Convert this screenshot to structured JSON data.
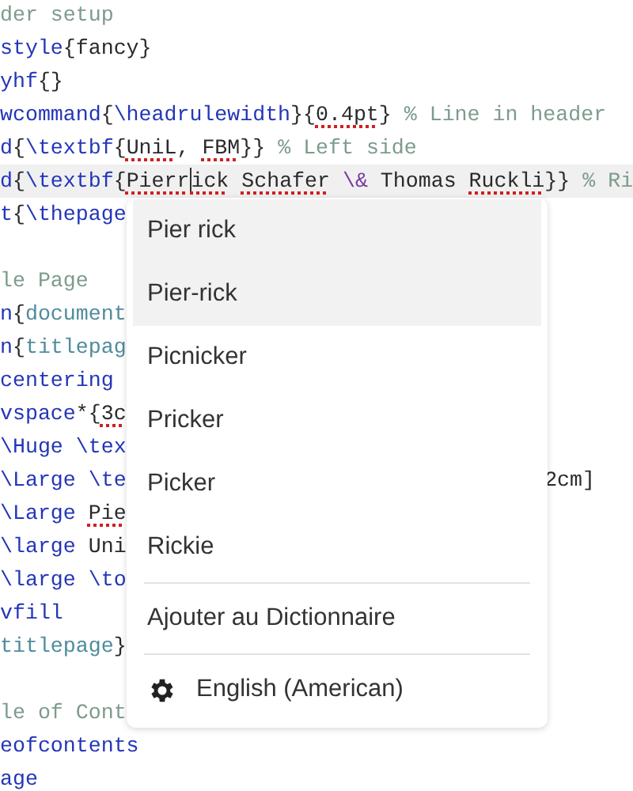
{
  "editor": {
    "lines": [
      {
        "kind": "code",
        "segments": [
          {
            "kind": "comment",
            "text": "der setup"
          }
        ]
      },
      {
        "kind": "code",
        "segments": [
          {
            "kind": "command",
            "text": "style"
          },
          {
            "kind": "text",
            "text": "{fancy}"
          }
        ]
      },
      {
        "kind": "code",
        "segments": [
          {
            "kind": "command",
            "text": "yhf"
          },
          {
            "kind": "text",
            "text": "{}"
          }
        ]
      },
      {
        "kind": "code",
        "segments": [
          {
            "kind": "command",
            "text": "wcommand"
          },
          {
            "kind": "text",
            "text": "{"
          },
          {
            "kind": "command",
            "text": "\\headrulewidth"
          },
          {
            "kind": "text",
            "text": "}{"
          },
          {
            "kind": "misspelled",
            "text": "0.4pt"
          },
          {
            "kind": "text",
            "text": "} "
          },
          {
            "kind": "comment",
            "text": "% Line in header"
          }
        ]
      },
      {
        "kind": "code",
        "segments": [
          {
            "kind": "command",
            "text": "d"
          },
          {
            "kind": "text",
            "text": "{"
          },
          {
            "kind": "command",
            "text": "\\textbf"
          },
          {
            "kind": "text",
            "text": "{"
          },
          {
            "kind": "misspelled",
            "text": "UniL"
          },
          {
            "kind": "text",
            "text": ", "
          },
          {
            "kind": "misspelled",
            "text": "FBM"
          },
          {
            "kind": "text",
            "text": "}} "
          },
          {
            "kind": "comment",
            "text": "% Left side"
          }
        ]
      },
      {
        "kind": "code",
        "current": true,
        "segments": [
          {
            "kind": "command",
            "text": "d"
          },
          {
            "kind": "text",
            "text": "{"
          },
          {
            "kind": "command",
            "text": "\\textbf"
          },
          {
            "kind": "text",
            "text": "{"
          },
          {
            "kind": "misspelled",
            "text": "Pierr"
          },
          {
            "kind": "cursor"
          },
          {
            "kind": "misspelled",
            "text": "ick"
          },
          {
            "kind": "misspelled",
            "text": "Schafer",
            "spaced": true
          },
          {
            "kind": "special",
            "text": "\\&",
            "spaced": true
          },
          {
            "kind": "text",
            "text": " Thomas "
          },
          {
            "kind": "misspelled",
            "text": "Ruckli"
          },
          {
            "kind": "text",
            "text": "}} "
          },
          {
            "kind": "comment",
            "text": "% Ri"
          }
        ]
      },
      {
        "kind": "code",
        "segments": [
          {
            "kind": "command",
            "text": "t"
          },
          {
            "kind": "text",
            "text": "{"
          },
          {
            "kind": "command",
            "text": "\\thepage"
          }
        ]
      },
      {
        "kind": "blank"
      },
      {
        "kind": "code",
        "segments": [
          {
            "kind": "comment",
            "text": "le Page"
          }
        ]
      },
      {
        "kind": "code",
        "segments": [
          {
            "kind": "command",
            "text": "n"
          },
          {
            "kind": "text",
            "text": "{"
          },
          {
            "kind": "env",
            "text": "document"
          }
        ]
      },
      {
        "kind": "code",
        "segments": [
          {
            "kind": "command",
            "text": "n"
          },
          {
            "kind": "text",
            "text": "{"
          },
          {
            "kind": "env",
            "text": "titlepag"
          }
        ]
      },
      {
        "kind": "code",
        "segments": [
          {
            "kind": "command",
            "text": "centering"
          }
        ]
      },
      {
        "kind": "code",
        "segments": [
          {
            "kind": "command",
            "text": "vspace"
          },
          {
            "kind": "text",
            "text": "*{"
          },
          {
            "kind": "misspelled",
            "text": "3c"
          }
        ]
      },
      {
        "kind": "code",
        "segments": [
          {
            "kind": "command",
            "text": "\\Huge"
          },
          {
            "kind": "command",
            "text": "\\tex",
            "spaced": true
          }
        ]
      },
      {
        "kind": "code",
        "segments": [
          {
            "kind": "command",
            "text": "\\Large"
          },
          {
            "kind": "command",
            "text": "\\te",
            "spaced": true
          }
        ],
        "tail": "2cm]"
      },
      {
        "kind": "code",
        "segments": [
          {
            "kind": "command",
            "text": "\\Large"
          },
          {
            "kind": "misspelled",
            "text": "Pie",
            "spaced": true
          }
        ]
      },
      {
        "kind": "code",
        "segments": [
          {
            "kind": "command",
            "text": "\\large"
          },
          {
            "kind": "text",
            "text": " Uni"
          }
        ]
      },
      {
        "kind": "code",
        "segments": [
          {
            "kind": "command",
            "text": "\\large"
          },
          {
            "kind": "command",
            "text": "\\to",
            "spaced": true
          }
        ]
      },
      {
        "kind": "code",
        "segments": [
          {
            "kind": "command",
            "text": "vfill"
          }
        ]
      },
      {
        "kind": "code",
        "segments": [
          {
            "kind": "env",
            "text": "titlepage"
          },
          {
            "kind": "text",
            "text": "}"
          }
        ]
      },
      {
        "kind": "blank"
      },
      {
        "kind": "code",
        "segments": [
          {
            "kind": "comment",
            "text": "le of Cont"
          }
        ]
      },
      {
        "kind": "code",
        "segments": [
          {
            "kind": "command",
            "text": "eofcontents"
          }
        ]
      },
      {
        "kind": "code",
        "segments": [
          {
            "kind": "command",
            "text": "age"
          }
        ]
      }
    ]
  },
  "spell_menu": {
    "suggestions": [
      {
        "label": "Pier rick",
        "highlighted": true
      },
      {
        "label": "Pier-rick",
        "highlighted": true
      },
      {
        "label": "Picnicker",
        "highlighted": false
      },
      {
        "label": "Pricker",
        "highlighted": false
      },
      {
        "label": "Picker",
        "highlighted": false
      },
      {
        "label": "Rickie",
        "highlighted": false
      }
    ],
    "add_to_dictionary": "Ajouter au Dictionnaire",
    "language": "English (American)"
  }
}
